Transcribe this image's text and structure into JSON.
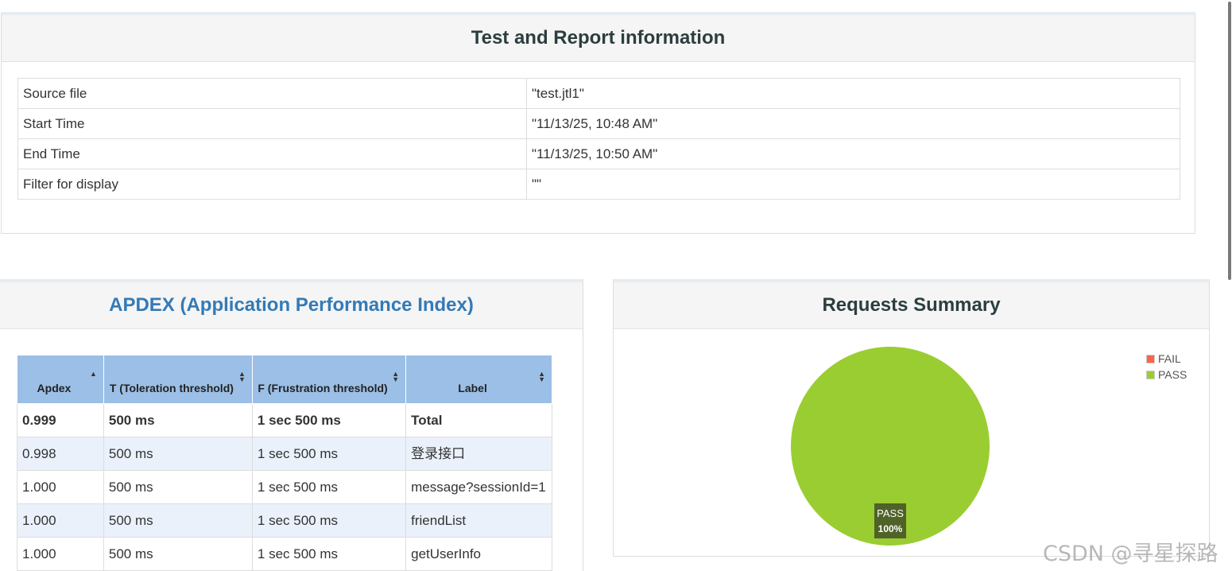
{
  "info_panel": {
    "title": "Test and Report information",
    "rows": [
      {
        "key": "Source file",
        "value": "\"test.jtl1\""
      },
      {
        "key": "Start Time",
        "value": "\"11/13/25, 10:48 AM\""
      },
      {
        "key": "End Time",
        "value": "\"11/13/25, 10:50 AM\""
      },
      {
        "key": "Filter for display",
        "value": "\"\""
      }
    ]
  },
  "apdex_panel": {
    "title": "APDEX (Application Performance Index)",
    "headers": [
      "Apdex",
      "T (Toleration threshold)",
      "F (Frustration threshold)",
      "Label"
    ],
    "rows": [
      [
        "0.999",
        "500 ms",
        "1 sec 500 ms",
        "Total"
      ],
      [
        "0.998",
        "500 ms",
        "1 sec 500 ms",
        "登录接口"
      ],
      [
        "1.000",
        "500 ms",
        "1 sec 500 ms",
        "message?sessionId=1"
      ],
      [
        "1.000",
        "500 ms",
        "1 sec 500 ms",
        "friendList"
      ],
      [
        "1.000",
        "500 ms",
        "1 sec 500 ms",
        "getUserInfo"
      ]
    ]
  },
  "summary_panel": {
    "title": "Requests Summary",
    "legend": [
      {
        "label": "FAIL",
        "color": "#ff6347"
      },
      {
        "label": "PASS",
        "color": "#9acd32"
      }
    ],
    "slice_label": "PASS",
    "slice_percent": "100%"
  },
  "chart_data": {
    "type": "pie",
    "categories": [
      "FAIL",
      "PASS"
    ],
    "values": [
      0,
      100
    ],
    "colors": [
      "#ff6347",
      "#9acd32"
    ],
    "title": "Requests Summary",
    "legend_position": "top-right"
  },
  "watermark": "CSDN @寻星探路"
}
